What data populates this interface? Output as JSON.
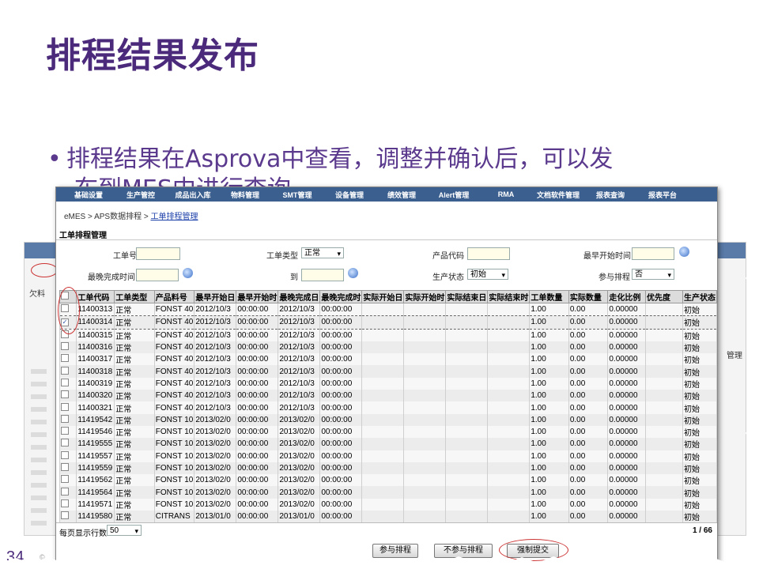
{
  "slide": {
    "title": "排程结果发布",
    "bullet": "排程结果在Asprova中查看，调整并确认后，可以发",
    "bullet_cont": "布到MES中进行查询",
    "page_number": "34",
    "copyright": "©"
  },
  "background_window": {
    "left_label": "欠料",
    "right_label": "管理"
  },
  "menu": [
    "基础设置",
    "生产管控",
    "成品出入库",
    "物料管理",
    "SMT管理",
    "设备管理",
    "绩效管理",
    "Alert管理",
    "RMA",
    "文档软件管理",
    "报表查询",
    "报表平台"
  ],
  "breadcrumb": {
    "prefix": "eMES > APS数据排程 > ",
    "link": "工单排程管理"
  },
  "section_title": "工单排程管理",
  "filters": {
    "order_no_label": "工单号",
    "order_type_label": "工单类型",
    "order_type_value": "正常",
    "product_code_label": "产品代码",
    "earliest_start_label": "最早开始时间",
    "latest_finish_label": "最晚完成时间",
    "to_label": "到",
    "prod_status_label": "生产状态",
    "prod_status_value": "初始",
    "participate_label": "参与排程",
    "participate_value": "否"
  },
  "table": {
    "headers": [
      "工单代码",
      "工单类型",
      "产品料号",
      "最早开始日",
      "最早开始时",
      "最晚完成日",
      "最晚完成时",
      "实际开始日",
      "实际开始时",
      "实际结束日",
      "实际结束时",
      "工单数量",
      "实际数量",
      "走化比例",
      "优先度",
      "生产状态"
    ],
    "rows": [
      [
        "11400313",
        "正常",
        "FONST 40",
        "2012/10/3",
        "00:00:00",
        "2012/10/3",
        "00:00:00",
        "",
        "",
        "",
        "",
        "1.00",
        "0.00",
        "0.00000",
        "",
        "初始"
      ],
      [
        "11400314",
        "正常",
        "FONST 40",
        "2012/10/3",
        "00:00:00",
        "2012/10/3",
        "00:00:00",
        "",
        "",
        "",
        "",
        "1.00",
        "0.00",
        "0.00000",
        "",
        "初始"
      ],
      [
        "11400315",
        "正常",
        "FONST 40",
        "2012/10/3",
        "00:00:00",
        "2012/10/3",
        "00:00:00",
        "",
        "",
        "",
        "",
        "1.00",
        "0.00",
        "0.00000",
        "",
        "初始"
      ],
      [
        "11400316",
        "正常",
        "FONST 40",
        "2012/10/3",
        "00:00:00",
        "2012/10/3",
        "00:00:00",
        "",
        "",
        "",
        "",
        "1.00",
        "0.00",
        "0.00000",
        "",
        "初始"
      ],
      [
        "11400317",
        "正常",
        "FONST 40",
        "2012/10/3",
        "00:00:00",
        "2012/10/3",
        "00:00:00",
        "",
        "",
        "",
        "",
        "1.00",
        "0.00",
        "0.00000",
        "",
        "初始"
      ],
      [
        "11400318",
        "正常",
        "FONST 40",
        "2012/10/3",
        "00:00:00",
        "2012/10/3",
        "00:00:00",
        "",
        "",
        "",
        "",
        "1.00",
        "0.00",
        "0.00000",
        "",
        "初始"
      ],
      [
        "11400319",
        "正常",
        "FONST 40",
        "2012/10/3",
        "00:00:00",
        "2012/10/3",
        "00:00:00",
        "",
        "",
        "",
        "",
        "1.00",
        "0.00",
        "0.00000",
        "",
        "初始"
      ],
      [
        "11400320",
        "正常",
        "FONST 40",
        "2012/10/3",
        "00:00:00",
        "2012/10/3",
        "00:00:00",
        "",
        "",
        "",
        "",
        "1.00",
        "0.00",
        "0.00000",
        "",
        "初始"
      ],
      [
        "11400321",
        "正常",
        "FONST 40",
        "2012/10/3",
        "00:00:00",
        "2012/10/3",
        "00:00:00",
        "",
        "",
        "",
        "",
        "1.00",
        "0.00",
        "0.00000",
        "",
        "初始"
      ],
      [
        "11419542",
        "正常",
        "FONST 10",
        "2013/02/0",
        "00:00:00",
        "2013/02/0",
        "00:00:00",
        "",
        "",
        "",
        "",
        "1.00",
        "0.00",
        "0.00000",
        "",
        "初始"
      ],
      [
        "11419546",
        "正常",
        "FONST 10",
        "2013/02/0",
        "00:00:00",
        "2013/02/0",
        "00:00:00",
        "",
        "",
        "",
        "",
        "1.00",
        "0.00",
        "0.00000",
        "",
        "初始"
      ],
      [
        "11419555",
        "正常",
        "FONST 10",
        "2013/02/0",
        "00:00:00",
        "2013/02/0",
        "00:00:00",
        "",
        "",
        "",
        "",
        "1.00",
        "0.00",
        "0.00000",
        "",
        "初始"
      ],
      [
        "11419557",
        "正常",
        "FONST 10",
        "2013/02/0",
        "00:00:00",
        "2013/02/0",
        "00:00:00",
        "",
        "",
        "",
        "",
        "1.00",
        "0.00",
        "0.00000",
        "",
        "初始"
      ],
      [
        "11419559",
        "正常",
        "FONST 10",
        "2013/02/0",
        "00:00:00",
        "2013/02/0",
        "00:00:00",
        "",
        "",
        "",
        "",
        "1.00",
        "0.00",
        "0.00000",
        "",
        "初始"
      ],
      [
        "11419562",
        "正常",
        "FONST 10",
        "2013/02/0",
        "00:00:00",
        "2013/02/0",
        "00:00:00",
        "",
        "",
        "",
        "",
        "1.00",
        "0.00",
        "0.00000",
        "",
        "初始"
      ],
      [
        "11419564",
        "正常",
        "FONST 10",
        "2013/02/0",
        "00:00:00",
        "2013/02/0",
        "00:00:00",
        "",
        "",
        "",
        "",
        "1.00",
        "0.00",
        "0.00000",
        "",
        "初始"
      ],
      [
        "11419571",
        "正常",
        "FONST 10",
        "2013/02/0",
        "00:00:00",
        "2013/02/0",
        "00:00:00",
        "",
        "",
        "",
        "",
        "1.00",
        "0.00",
        "0.00000",
        "",
        "初始"
      ],
      [
        "11419580",
        "正常",
        "CITRANS",
        "2013/01/0",
        "00:00:00",
        "2013/01/0",
        "00:00:00",
        "",
        "",
        "",
        "",
        "1.00",
        "0.00",
        "0.00000",
        "",
        "初始"
      ]
    ],
    "checked_row_index": 1
  },
  "footer": {
    "per_page_label": "每页显示行数",
    "per_page_value": "50",
    "page_info": "1 / 66",
    "btn_participate": "参与排程",
    "btn_not_participate": "不参与排程",
    "btn_force_submit": "强制提交"
  },
  "colors": {
    "title": "#4b2a7b",
    "menubar": "#3b5f8f",
    "annotation_circle": "#cc3333"
  }
}
